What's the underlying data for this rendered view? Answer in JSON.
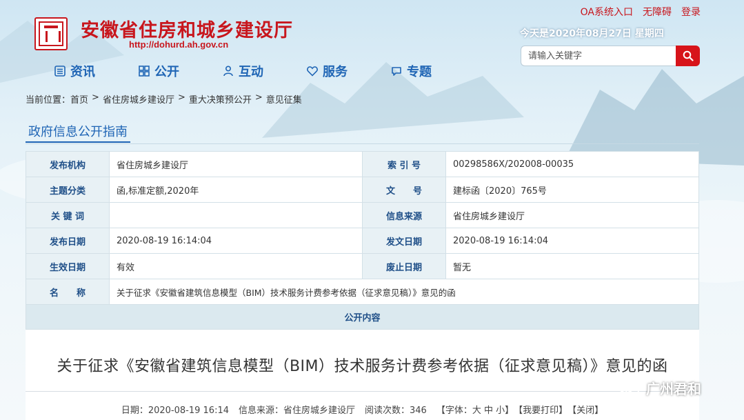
{
  "header": {
    "site_title": "安徽省住房和城乡建设厅",
    "site_url": "http://dohurd.ah.gov.cn",
    "top_links": [
      "OA系统入口",
      "无障碍",
      "登录"
    ],
    "date_text": "今天是2020年08月27日 星期四",
    "search": {
      "placeholder": "请输入关键字"
    }
  },
  "nav": [
    {
      "label": "资讯",
      "icon": "list-icon"
    },
    {
      "label": "公开",
      "icon": "grid-icon"
    },
    {
      "label": "互动",
      "icon": "people-icon"
    },
    {
      "label": "服务",
      "icon": "heart-icon"
    },
    {
      "label": "专题",
      "icon": "chat-icon"
    }
  ],
  "breadcrumb": {
    "prefix": "当前位置：",
    "items": [
      "首页",
      "省住房城乡建设厅",
      "重大决策预公开",
      "意见征集"
    ],
    "sep": ">"
  },
  "guide_tab": "政府信息公开指南",
  "info": {
    "publisher_k": "发布机构",
    "publisher_v": "省住房城乡建设厅",
    "index_k": "索 引 号",
    "index_v": "00298586X/202008-00035",
    "topic_k": "主题分类",
    "topic_v": "函,标准定额,2020年",
    "docno_k": "文　　号",
    "docno_v": "建标函〔2020〕765号",
    "keywords_k": "关 键 词",
    "keywords_v": "",
    "source_k": "信息来源",
    "source_v": "省住房城乡建设厅",
    "pubdate_k": "发布日期",
    "pubdate_v": "2020-08-19 16:14:04",
    "docdate_k": "发文日期",
    "docdate_v": "2020-08-19 16:14:04",
    "effdate_k": "生效日期",
    "effdate_v": "有效",
    "abolish_k": "废止日期",
    "abolish_v": "暂无",
    "name_k": "名　　称",
    "name_v": "关于征求《安徽省建筑信息模型（BIM）技术服务计费参考依据（征求意见稿）》意见的函",
    "open_content": "公开内容"
  },
  "article": {
    "title": "关于征求《安徽省建筑信息模型（BIM）技术服务计费参考依据（征求意见稿）》意见的函",
    "date": "日期：2020-08-19 16:14",
    "source": "信息来源：省住房城乡建设厅",
    "views": "阅读次数：346",
    "font_opts": "【字体：大 中 小】",
    "print": "【我要打印】",
    "close": "【关闭】"
  },
  "watermark": "广州君和",
  "colors": {
    "brand_red": "#c8161d",
    "nav_blue": "#1f65b5",
    "search_red": "#d7141a"
  }
}
